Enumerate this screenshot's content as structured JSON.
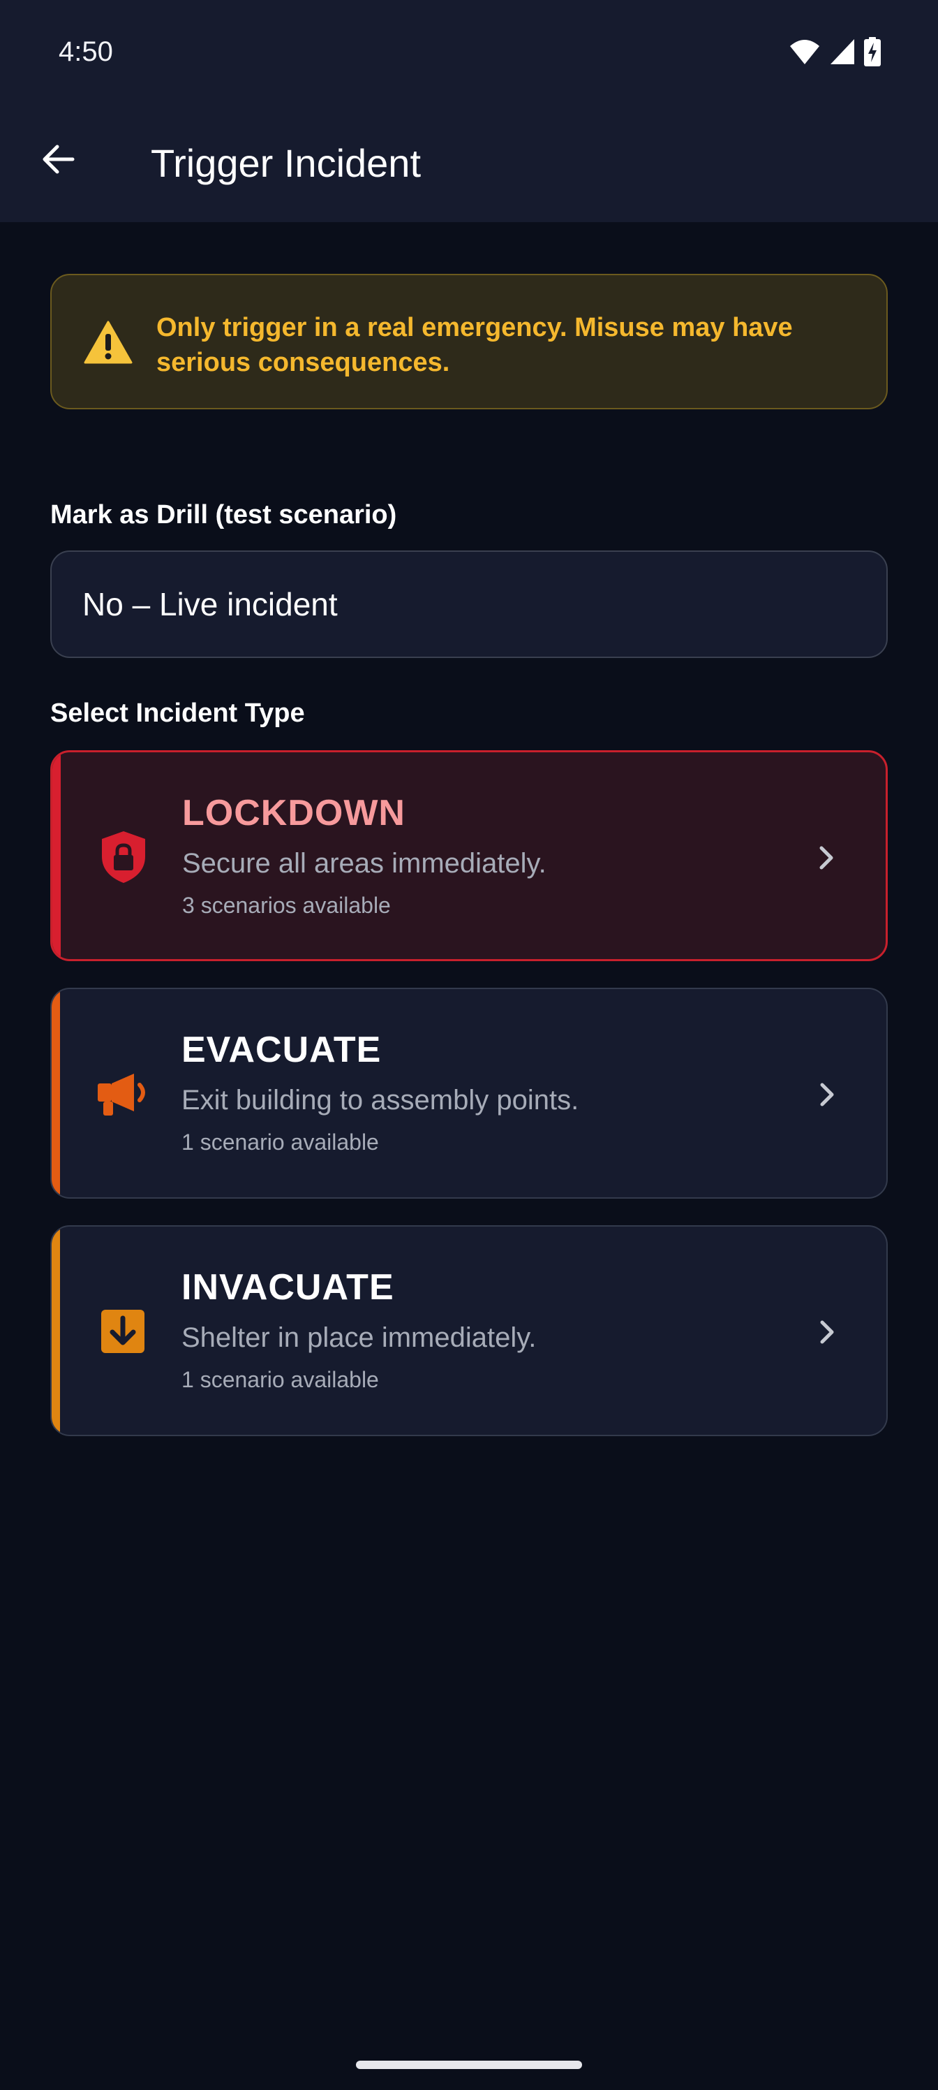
{
  "status_bar": {
    "time": "4:50",
    "icons": [
      "wifi-icon",
      "cell-signal-icon",
      "battery-charging-icon"
    ]
  },
  "app_bar": {
    "back_icon": "arrow-back-icon",
    "title": "Trigger Incident"
  },
  "warning": {
    "icon": "warning-icon",
    "text": "Only trigger in a real emergency. Misuse may have serious consequences."
  },
  "drill": {
    "label": "Mark as Drill (test scenario)",
    "value": "No – Live incident"
  },
  "incident_section": {
    "label": "Select Incident Type",
    "types": [
      {
        "name": "LOCKDOWN",
        "description": "Secure all areas immediately.",
        "count": "3 scenarios available",
        "icon": "shield-lock-icon",
        "accent": "#d81f2f"
      },
      {
        "name": "EVACUATE",
        "description": "Exit building to assembly points.",
        "count": "1 scenario available",
        "icon": "megaphone-icon",
        "accent": "#e35c13"
      },
      {
        "name": "INVACUATE",
        "description": "Shelter in place immediately.",
        "count": "1 scenario available",
        "icon": "arrow-down-box-icon",
        "accent": "#e08511"
      }
    ]
  },
  "colors": {
    "background": "#0a0e1a",
    "surface": "#161b2e",
    "warning_text": "#f5b82e",
    "lockdown_accent": "#d81f2f",
    "evacuate_accent": "#e35c13",
    "invacuate_accent": "#e08511"
  }
}
